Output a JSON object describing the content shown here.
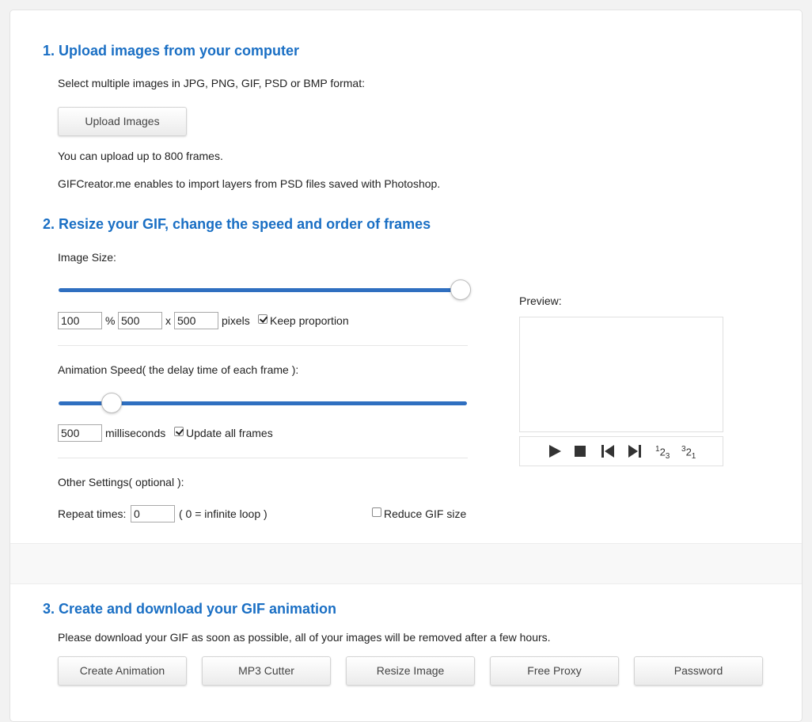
{
  "step1": {
    "title": "1. Upload images from your computer",
    "instructions": "Select multiple images in JPG, PNG, GIF, PSD or BMP format:",
    "upload_button": "Upload Images",
    "limit_text": "You can upload up to 800 frames.",
    "psd_text": "GIFCreator.me enables to import layers from PSD files saved with Photoshop."
  },
  "step2": {
    "title": "2. Resize your GIF, change the speed and order of frames",
    "size": {
      "label": "Image Size:",
      "slider_fraction": 1.0,
      "percent_value": "100",
      "percent_sign": "%",
      "width_value": "500",
      "x_sign": "x",
      "height_value": "500",
      "units": "pixels",
      "keep_proportion_label": "Keep proportion",
      "keep_proportion_checked": true
    },
    "speed": {
      "label": "Animation Speed( the delay time of each frame ):",
      "slider_fraction": 0.11,
      "ms_value": "500",
      "units": "milliseconds",
      "update_all_label": "Update all frames",
      "update_all_checked": true
    },
    "other": {
      "label": "Other Settings( optional ):",
      "repeat_label": "Repeat times:",
      "repeat_value": "0",
      "repeat_hint": "( 0 = infinite loop )",
      "reduce_label": "Reduce GIF size",
      "reduce_checked": false
    },
    "preview": {
      "label": "Preview:",
      "controls": {
        "play": "play-icon",
        "stop": "stop-icon",
        "first": "first-frame-icon",
        "last": "last-frame-icon",
        "order_asc_main": "1",
        "order_asc_sub": "2",
        "order_asc_sub2": "3",
        "order_desc_main": "3",
        "order_desc_sub": "2",
        "order_desc_sub2": "1"
      }
    }
  },
  "step3": {
    "title": "3. Create and download your GIF animation",
    "notice": "Please download your GIF as soon as possible, all of your images will be removed after a few hours.",
    "buttons": [
      "Create Animation",
      "MP3 Cutter",
      "Resize Image",
      "Free Proxy",
      "Password"
    ]
  },
  "colors": {
    "heading": "#1a6fc4",
    "slider": "#2f6fc0"
  }
}
